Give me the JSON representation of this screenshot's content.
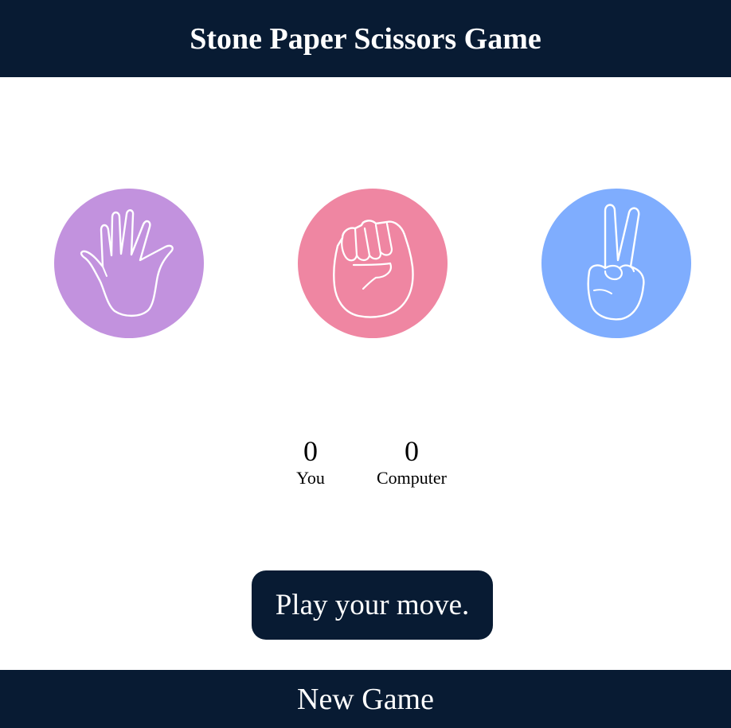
{
  "header": {
    "title": "Stone Paper Scissors Game"
  },
  "choices": [
    {
      "id": "paper",
      "icon": "open-hand-icon",
      "color": "#c292de"
    },
    {
      "id": "stone",
      "icon": "fist-icon",
      "color": "#ef86a2"
    },
    {
      "id": "scissors",
      "icon": "victory-hand-icon",
      "color": "#7fadfe"
    }
  ],
  "scoreboard": {
    "user": {
      "score": "0",
      "label": "You"
    },
    "computer": {
      "score": "0",
      "label": "Computer"
    }
  },
  "message": {
    "text": "Play your move."
  },
  "footer": {
    "new_game_label": "New Game"
  },
  "colors": {
    "navy": "#081b33",
    "paper": "#c292de",
    "stone": "#ef86a2",
    "scissors": "#7fadfe"
  }
}
